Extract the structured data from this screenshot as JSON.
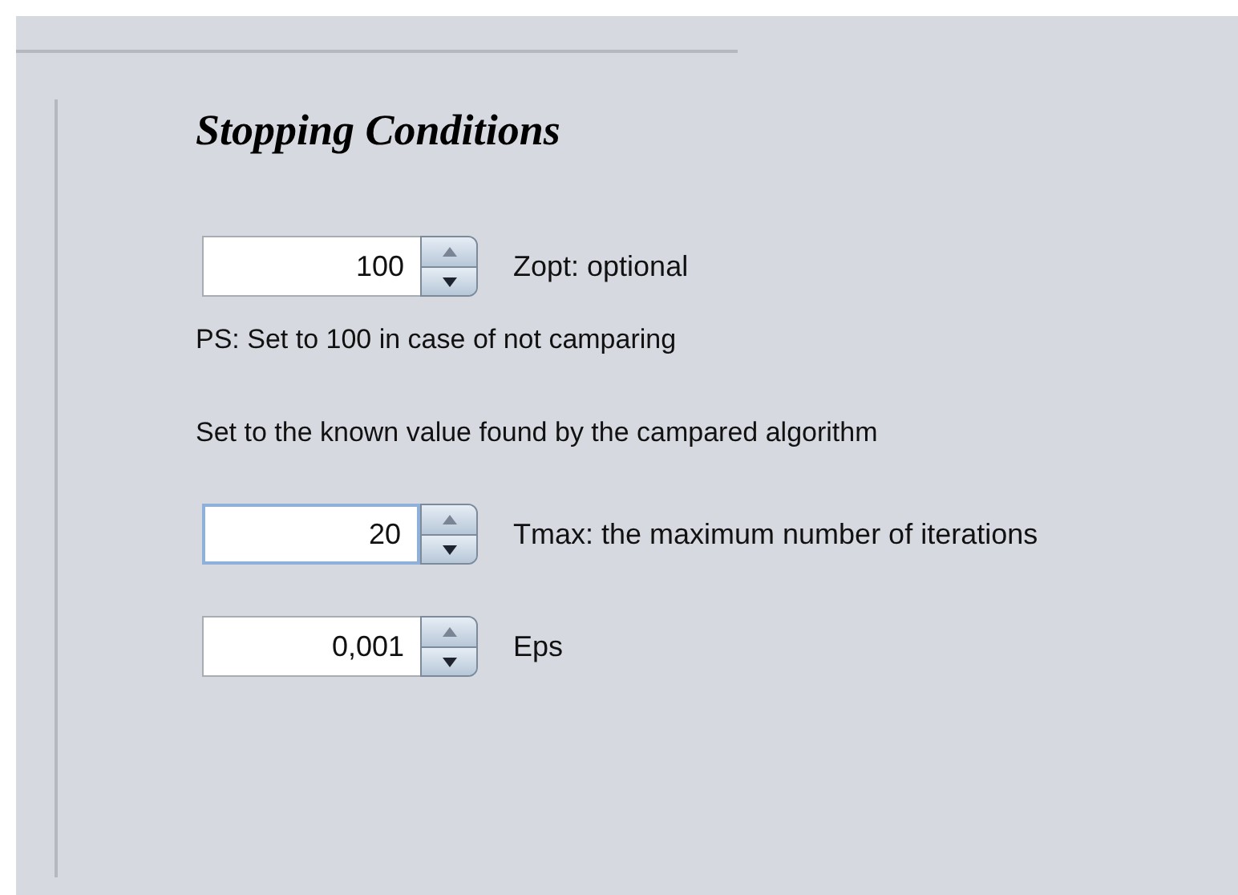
{
  "section": {
    "title": "Stopping Conditions"
  },
  "items": [
    {
      "kind": "spinner",
      "value": "100",
      "label": "Zopt: optional",
      "focused": false
    },
    {
      "kind": "note",
      "text": "PS: Set to 100 in case of not camparing"
    },
    {
      "kind": "note",
      "text": "Set to the known value found by the campared algorithm"
    },
    {
      "kind": "spinner",
      "value": "20",
      "label": "Tmax: the maximum number of iterations",
      "focused": true
    },
    {
      "kind": "spinner",
      "value": "0,001",
      "label": "Eps",
      "focused": false
    }
  ]
}
